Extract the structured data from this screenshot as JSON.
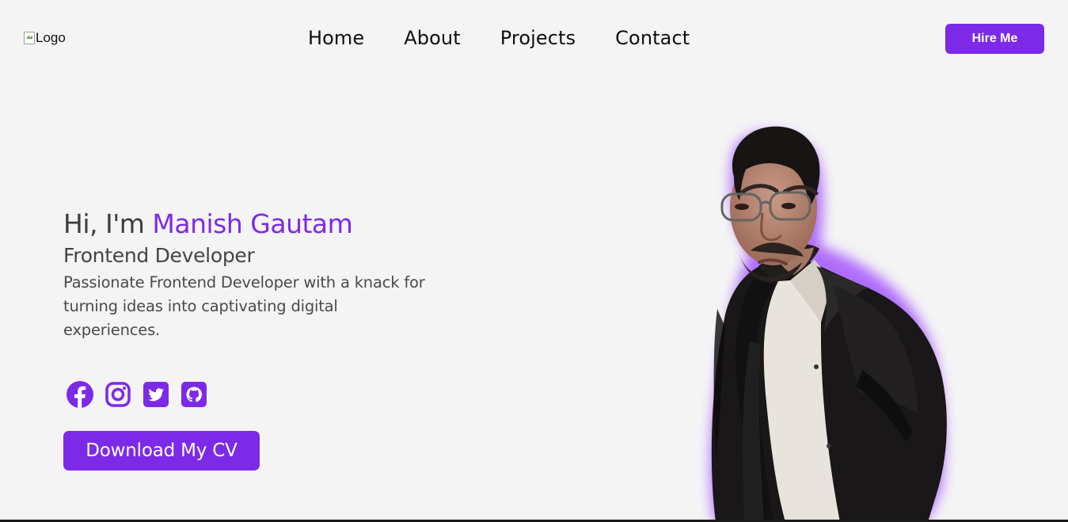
{
  "header": {
    "logo_alt": "Logo",
    "nav": [
      {
        "label": "Home"
      },
      {
        "label": "About"
      },
      {
        "label": "Projects"
      },
      {
        "label": "Contact"
      }
    ],
    "hire_label": "Hire Me"
  },
  "hero": {
    "greeting_prefix": "Hi, I'm ",
    "name": "Manish Gautam",
    "role": "Frontend Developer",
    "description": "Passionate Frontend Developer with a knack for turning ideas into captivating digital experiences.",
    "cv_label": "Download My CV"
  },
  "socials": [
    {
      "icon": "facebook-icon"
    },
    {
      "icon": "instagram-icon"
    },
    {
      "icon": "twitter-icon"
    },
    {
      "icon": "github-icon"
    }
  ],
  "colors": {
    "accent": "#7c2ae8",
    "background": "#f4f4f5",
    "text": "#0f0f10"
  }
}
